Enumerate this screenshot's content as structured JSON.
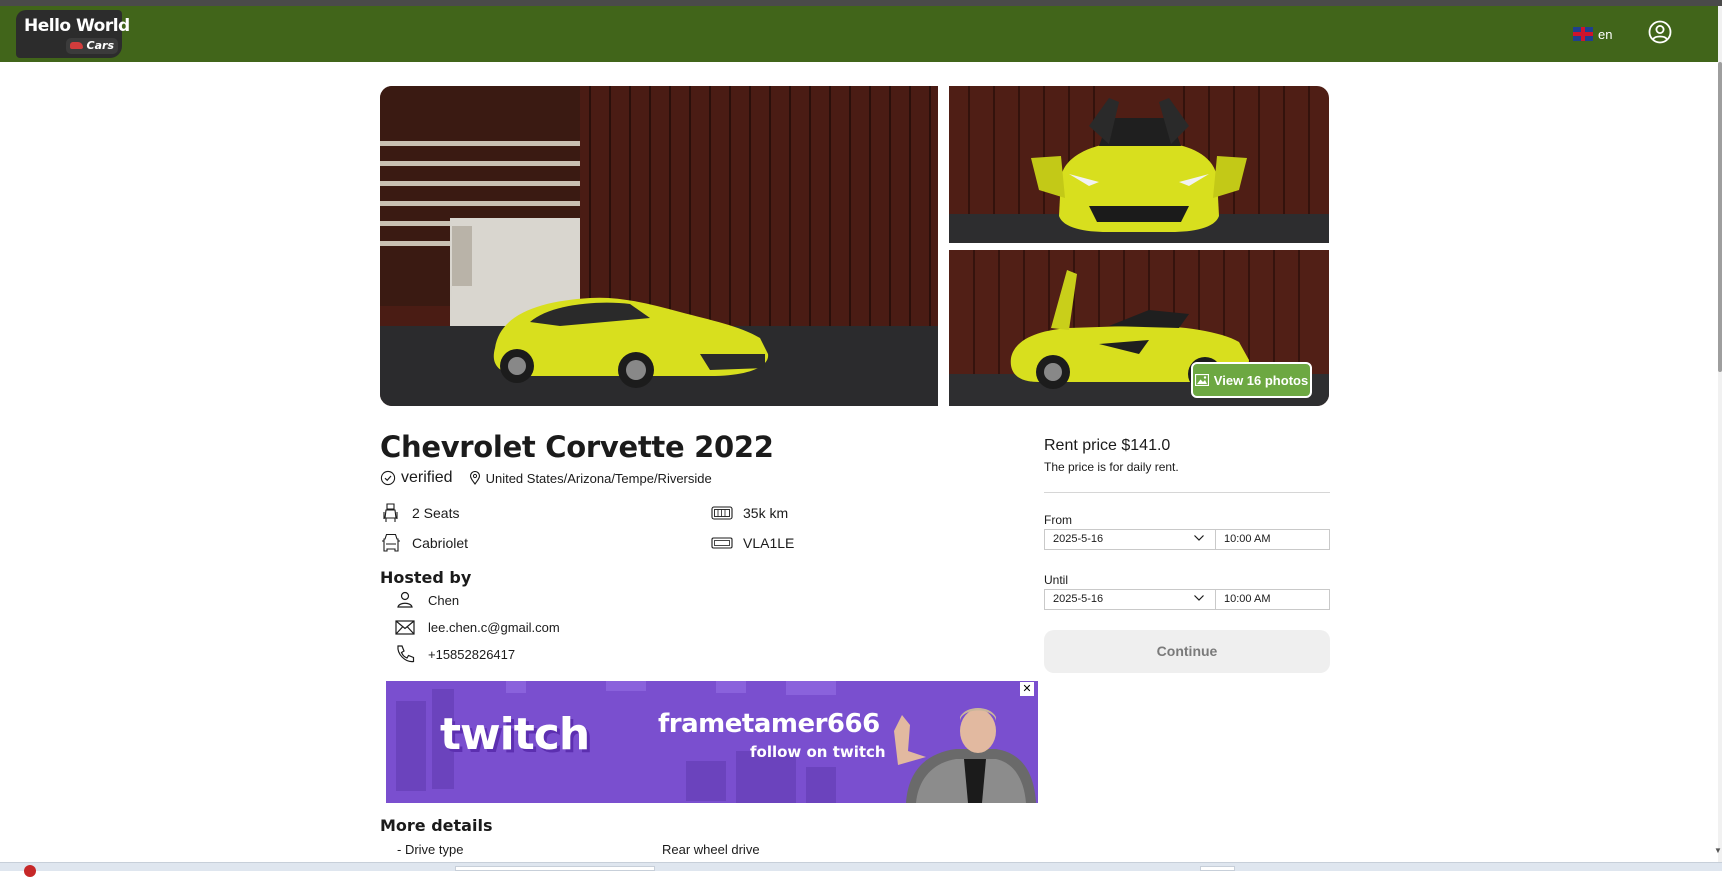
{
  "header": {
    "logo_main": "Hello World",
    "logo_sub": "Cars",
    "language": "en"
  },
  "gallery": {
    "view_photos_label": "View 16 photos"
  },
  "car": {
    "title": "Chevrolet Corvette 2022",
    "verified_label": "verified",
    "location": "United States/Arizona/Tempe/Riverside",
    "specs": {
      "seats": "2 Seats",
      "mileage": "35k km",
      "body": "Cabriolet",
      "plate": "VLA1LE"
    }
  },
  "host": {
    "heading": "Hosted by",
    "name": "Chen",
    "email": "lee.chen.c@gmail.com",
    "phone": "+15852826417"
  },
  "ad": {
    "brand": "twitch",
    "username": "frametamer666",
    "follow": "follow on twitch",
    "close": "✕"
  },
  "details": {
    "heading": "More details",
    "rows": [
      {
        "label": "- Drive type",
        "value": "Rear wheel drive"
      }
    ]
  },
  "booking": {
    "price_label": "Rent price $141.0",
    "price_note": "The price is for daily rent.",
    "from_label": "From",
    "from_date": "2025-5-16",
    "from_time": "10:00 AM",
    "until_label": "Until",
    "until_date": "2025-5-16",
    "until_time": "10:00 AM",
    "continue_label": "Continue"
  },
  "colors": {
    "navbar": "#41651a",
    "accent_button": "#6da842",
    "car_yellow": "#d8df1e",
    "ad_purple": "#7b4fd0"
  }
}
